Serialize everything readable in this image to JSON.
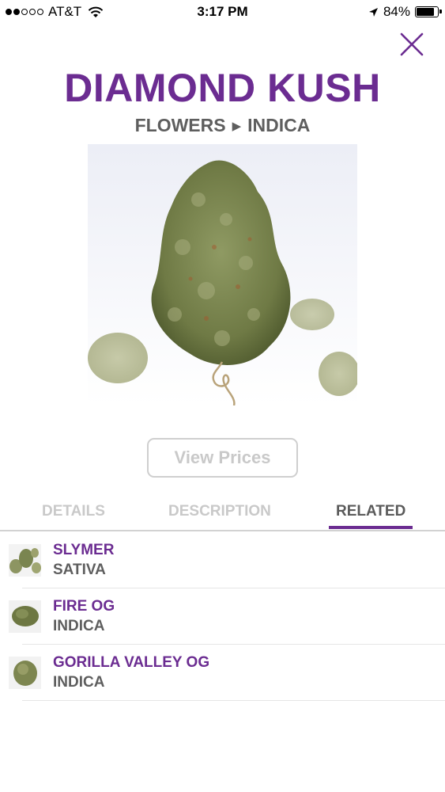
{
  "status_bar": {
    "carrier": "AT&T",
    "time": "3:17 PM",
    "battery": "84%",
    "battery_level": 0.84,
    "signal_bars_filled": 2,
    "signal_bars_total": 5
  },
  "product": {
    "name": "DIAMOND KUSH",
    "category": "FLOWERS",
    "type": "INDICA",
    "image": "cannabis-bud-photo"
  },
  "actions": {
    "view_prices": "View Prices"
  },
  "tabs": [
    {
      "label": "DETAILS",
      "active": false
    },
    {
      "label": "DESCRIPTION",
      "active": false
    },
    {
      "label": "RELATED",
      "active": true
    }
  ],
  "related": [
    {
      "name": "SLYMER",
      "type": "SATIVA"
    },
    {
      "name": "FIRE OG",
      "type": "INDICA"
    },
    {
      "name": "GORILLA VALLEY OG",
      "type": "INDICA"
    }
  ],
  "colors": {
    "accent": "#6b2c91",
    "text_gray": "#5e5e5e",
    "muted_gray": "#c9c9c9"
  }
}
